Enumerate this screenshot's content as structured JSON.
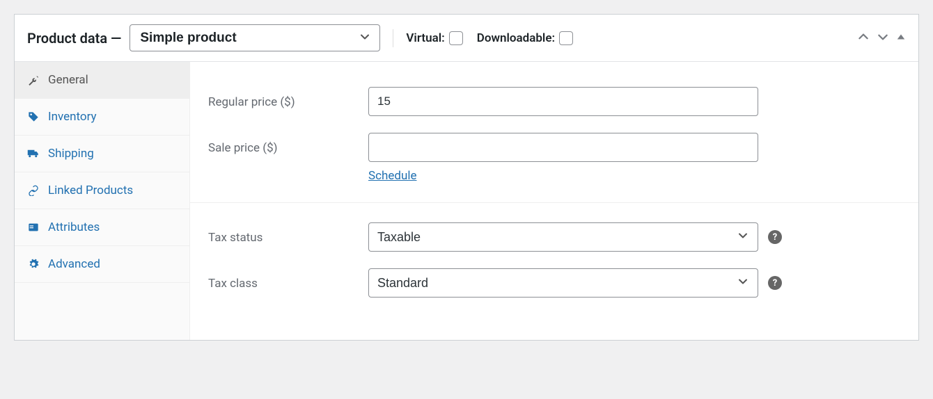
{
  "header": {
    "title": "Product data —",
    "product_type": "Simple product",
    "virtual_label": "Virtual:",
    "downloadable_label": "Downloadable:"
  },
  "sidebar": {
    "items": [
      {
        "label": "General",
        "icon": "wrench-icon",
        "active": true
      },
      {
        "label": "Inventory",
        "icon": "tag-icon",
        "active": false
      },
      {
        "label": "Shipping",
        "icon": "truck-icon",
        "active": false
      },
      {
        "label": "Linked Products",
        "icon": "link-icon",
        "active": false
      },
      {
        "label": "Attributes",
        "icon": "list-icon",
        "active": false
      },
      {
        "label": "Advanced",
        "icon": "gear-icon",
        "active": false
      }
    ]
  },
  "fields": {
    "regular_price_label": "Regular price ($)",
    "regular_price_value": "15",
    "sale_price_label": "Sale price ($)",
    "sale_price_value": "",
    "schedule_label": "Schedule",
    "tax_status_label": "Tax status",
    "tax_status_value": "Taxable",
    "tax_class_label": "Tax class",
    "tax_class_value": "Standard"
  }
}
